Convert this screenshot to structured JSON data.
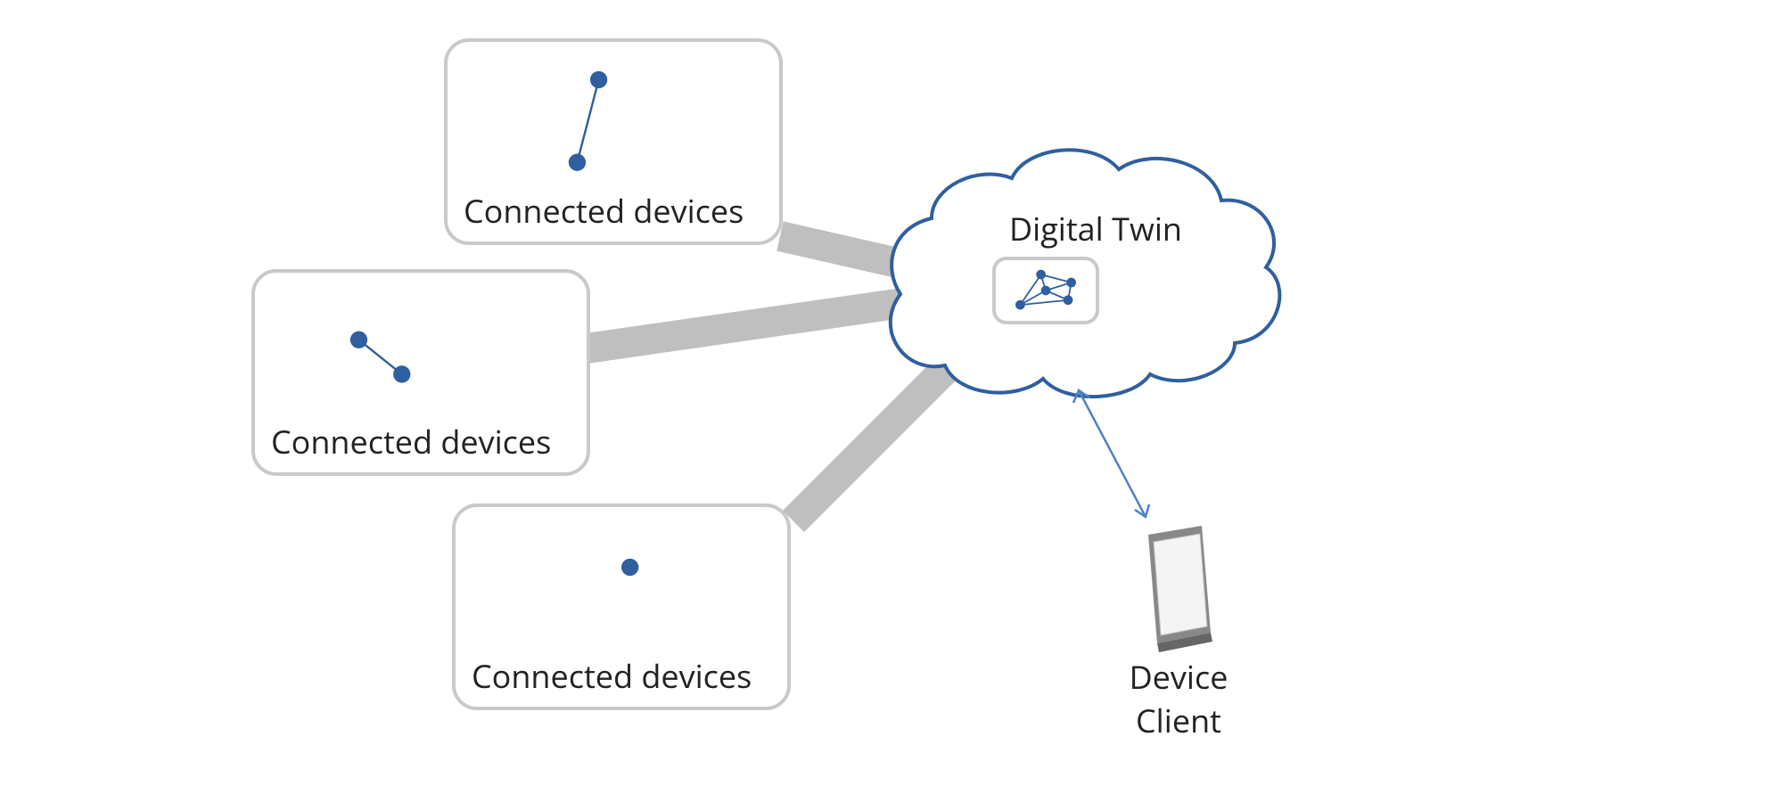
{
  "cards": {
    "top": {
      "label": "Connected devices"
    },
    "middle": {
      "label": "Connected devices"
    },
    "bottom": {
      "label": "Connected devices"
    }
  },
  "cloud": {
    "label": "Digital Twin"
  },
  "device": {
    "line1": "Device",
    "line2": "Client"
  },
  "colors": {
    "node": "#2f5f9e",
    "cloudStroke": "#2f5f9e",
    "cardBorder": "#c9c9c9",
    "connector": "#bfbfbf",
    "arrow": "#4f81c7"
  }
}
